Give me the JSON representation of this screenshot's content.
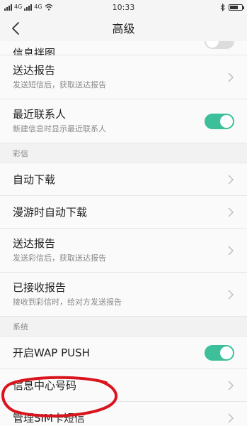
{
  "status": {
    "carriers": [
      "4G",
      "4G"
    ],
    "time": "10:33"
  },
  "header": {
    "title": "高级"
  },
  "rows_top": [
    {
      "title": "信息拌图",
      "toggle": "off",
      "kind": "partial"
    },
    {
      "title": "送达报告",
      "subtitle": "发送短信后，获取送达报告",
      "kind": "chevron"
    },
    {
      "title": "最近联系人",
      "subtitle": "新建信息时显示最近联系人",
      "kind": "toggle",
      "toggle": "on"
    }
  ],
  "mms_section": {
    "header": "彩信",
    "rows": [
      {
        "title": "自动下载",
        "kind": "chevron"
      },
      {
        "title": "漫游时自动下载",
        "kind": "chevron"
      },
      {
        "title": "送达报告",
        "subtitle": "发送彩信后，获取送达报告",
        "kind": "chevron"
      },
      {
        "title": "已接收报告",
        "subtitle": "接收到彩信时，给对方发送报告",
        "kind": "chevron"
      }
    ]
  },
  "system_section": {
    "header": "系统",
    "rows": [
      {
        "title": "开启WAP PUSH",
        "kind": "toggle",
        "toggle": "on"
      },
      {
        "title": "信息中心号码",
        "kind": "chevron"
      },
      {
        "title": "管理SIM卡短信",
        "kind": "chevron"
      }
    ]
  },
  "colors": {
    "accent": "#3dbf9b",
    "annotation": "#d9141c"
  }
}
